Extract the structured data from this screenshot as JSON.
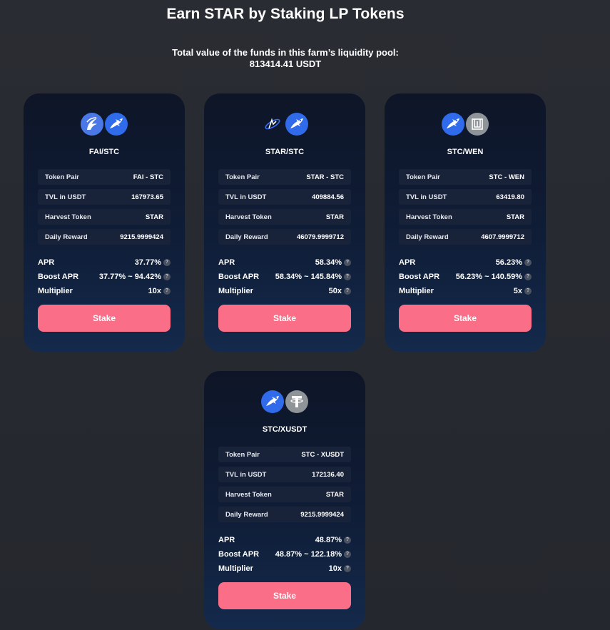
{
  "header": {
    "title": "Earn STAR by Staking LP Tokens",
    "tvl_line1": "Total value of the funds in this farm’s liquidity pool:",
    "tvl_line2": "813414.41 USDT"
  },
  "labels": {
    "token_pair": "Token Pair",
    "tvl": "TVL in USDT",
    "harvest_token": "Harvest Token",
    "daily_reward": "Daily Reward",
    "apr": "APR",
    "boost_apr": "Boost APR",
    "multiplier": "Multiplier",
    "stake": "Stake",
    "help": "?"
  },
  "farms": [
    {
      "name": "FAI/STC",
      "icons": [
        "fai-token-icon",
        "star-token-icon"
      ],
      "token_pair": "FAI - STC",
      "tvl": "167973.65",
      "harvest_token": "STAR",
      "daily_reward": "9215.9999424",
      "apr": "37.77%",
      "boost_apr": "37.77% ~ 94.42%",
      "multiplier": "10x"
    },
    {
      "name": "STAR/STC",
      "icons": [
        "stc-token-icon",
        "star-token-icon"
      ],
      "token_pair": "STAR - STC",
      "tvl": "409884.56",
      "harvest_token": "STAR",
      "daily_reward": "46079.9999712",
      "apr": "58.34%",
      "boost_apr": "58.34% ~ 145.84%",
      "multiplier": "50x"
    },
    {
      "name": "STC/WEN",
      "icons": [
        "star-token-icon",
        "wen-token-icon"
      ],
      "token_pair": "STC - WEN",
      "tvl": "63419.80",
      "harvest_token": "STAR",
      "daily_reward": "4607.9999712",
      "apr": "56.23%",
      "boost_apr": "56.23% ~ 140.59%",
      "multiplier": "5x"
    },
    {
      "name": "STC/XUSDT",
      "icons": [
        "star-token-icon",
        "usdt-token-icon"
      ],
      "token_pair": "STC - XUSDT",
      "tvl": "172136.40",
      "harvest_token": "STAR",
      "daily_reward": "9215.9999424",
      "apr": "48.87%",
      "boost_apr": "48.87% ~ 122.18%",
      "multiplier": "10x"
    }
  ],
  "colors": {
    "background": "#2a2c33",
    "card": "#0f1d37",
    "info_row": "#18233a",
    "stake_button": "#fb6e88",
    "star_icon": "#2f6bea",
    "neutral_icon": "#8f9499"
  }
}
